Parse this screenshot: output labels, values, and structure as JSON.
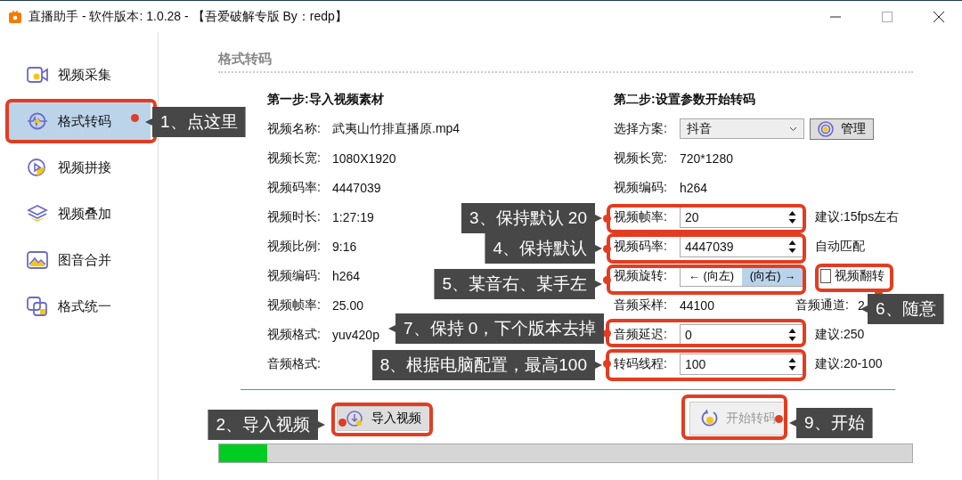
{
  "window": {
    "title": "直播助手 - 软件版本: 1.0.28 - 【吾爱破解专版 By：redp】"
  },
  "sidebar": {
    "items": [
      {
        "label": "视频采集",
        "selected": false
      },
      {
        "label": "格式转码",
        "selected": true
      },
      {
        "label": "视频拼接",
        "selected": false
      },
      {
        "label": "视频叠加",
        "selected": false
      },
      {
        "label": "图音合并",
        "selected": false
      },
      {
        "label": "格式统一",
        "selected": false
      }
    ]
  },
  "section_title": "格式转码",
  "source": {
    "heading": "第一步:导入视频素材",
    "rows": [
      {
        "label": "视频名称:",
        "value": "武夷山竹排直播原.mp4"
      },
      {
        "label": "视频长宽:",
        "value": "1080X1920"
      },
      {
        "label": "视频码率:",
        "value": "4447039"
      },
      {
        "label": "视频时长:",
        "value": "1:27:19"
      },
      {
        "label": "视频比例:",
        "value": "9:16"
      },
      {
        "label": "视频编码:",
        "value": "h264"
      },
      {
        "label": "视频帧率:",
        "value": "25.00"
      },
      {
        "label": "视频格式:",
        "value": "yuv420p"
      },
      {
        "label": "音频格式:"
      }
    ]
  },
  "settings": {
    "heading": "第二步:设置参数开始转码",
    "rows": [
      {
        "kind": "select",
        "label": "选择方案:",
        "value": "抖音",
        "button": "管理"
      },
      {
        "kind": "text",
        "label": "视频长宽:",
        "value": "720*1280"
      },
      {
        "kind": "text",
        "label": "视频编码:",
        "value": "h264"
      },
      {
        "kind": "spin",
        "label": "视频帧率:",
        "value": "20",
        "hint": "建议:15fps左右"
      },
      {
        "kind": "spin",
        "label": "视频码率:",
        "value": "4447039",
        "hint": "自动匹配"
      },
      {
        "kind": "rotate",
        "label": "视频旋转:",
        "options": [
          {
            "label": "← (向左)",
            "selected": false
          },
          {
            "label": "(向右) →",
            "selected": true
          }
        ],
        "checkbox": {
          "label": "视频翻转",
          "checked": false
        }
      },
      {
        "kind": "pair",
        "label": "音频采样:",
        "value": "44100",
        "label_2": "音频通道:",
        "value_2": "2"
      },
      {
        "kind": "spin",
        "label": "音频延迟:",
        "value": "0",
        "hint": "建议:250"
      },
      {
        "kind": "spin",
        "label": "转码线程:",
        "value": "100",
        "hint": "建议:20-100"
      }
    ]
  },
  "import_button": "导入视频",
  "start_button": {
    "label": "开始转码",
    "disabled": true
  },
  "progress": {
    "level": 0.07
  },
  "callouts": [
    {
      "text": "1、点这里"
    },
    {
      "text": "2、导入视频"
    },
    {
      "text": "3、保持默认 20"
    },
    {
      "text": "4、保持默认"
    },
    {
      "text": "5、某音右、某手左"
    },
    {
      "text": "6、随意"
    },
    {
      "text": "7、保持 0，下个版本去掉"
    },
    {
      "text": "8、根据电脑配置，最高100"
    },
    {
      "text": "9、开始"
    }
  ]
}
